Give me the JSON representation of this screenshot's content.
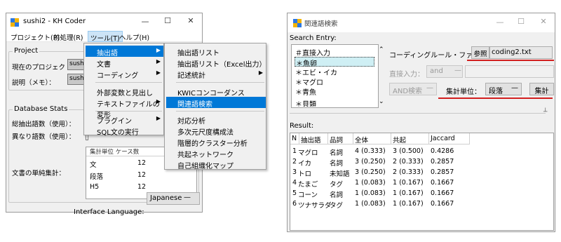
{
  "left_window": {
    "title": "sushi2 - KH Coder",
    "controls": {
      "minimize": "—",
      "maximize": "☐",
      "close": "✕"
    },
    "menubar": {
      "project": "プロジェクト(P)",
      "preprocess": "前処理(R)",
      "tools": "ツール(T)",
      "help": "ヘルプ(H)"
    },
    "project_group": {
      "legend": "Project",
      "current_project_label": "現在のプロジェクト：",
      "current_project_value": "sush",
      "memo_label": "説明（メモ）：",
      "memo_value": "sush"
    },
    "stats_group": {
      "legend": "Database Stats",
      "total_words_label": "総抽出語数（使用）：",
      "distinct_words_label": "異なり語数（使用）：",
      "unit_count_label": "文書の単純集計：",
      "unit_table": {
        "header": "集計単位 ケース数",
        "rows": [
          {
            "name": "文",
            "count": "12"
          },
          {
            "name": "段落",
            "count": "12"
          },
          {
            "name": "H5",
            "count": "12"
          }
        ]
      }
    },
    "interface_language_label": "Interface Language:",
    "interface_language_value": "Japanese"
  },
  "tools_menu": {
    "items": [
      {
        "label": "抽出語",
        "has_submenu": true,
        "highlighted": true
      },
      {
        "label": "文書",
        "has_submenu": true
      },
      {
        "label": "コーディング",
        "has_submenu": true
      },
      {
        "label": "外部変数と見出し",
        "has_submenu": false
      },
      {
        "label": "テキストファイルの変形",
        "has_submenu": true
      },
      {
        "label": "プラグイン",
        "has_submenu": true
      },
      {
        "label": "SQL文の実行",
        "has_submenu": false
      }
    ]
  },
  "sub_menu": {
    "items": [
      {
        "label": "抽出語リスト"
      },
      {
        "label": "抽出語リスト（Excel出力）"
      },
      {
        "label": "記述統計",
        "has_submenu": true
      },
      {
        "label": "KWICコンコーダンス"
      },
      {
        "label": "関連語検索",
        "highlighted": true
      },
      {
        "label": "対応分析"
      },
      {
        "label": "多次元尺度構成法"
      },
      {
        "label": "階層的クラスター分析"
      },
      {
        "label": "共起ネットワーク"
      },
      {
        "label": "自己組織化マップ"
      }
    ]
  },
  "right_window": {
    "title": "関連語検索",
    "controls": {
      "minimize": "—",
      "maximize": "☐",
      "close": "✕"
    },
    "search_entry_label": "Search Entry:",
    "entries": [
      "＃直接入力",
      "＊魚卵",
      "＊エビ・イカ",
      "＊マグロ",
      "＊青魚",
      "＊貝類"
    ],
    "selected_entry_index": 1,
    "coding_rule_label": "コーディングルール・ファイル：",
    "browse_button": "参照",
    "coding_file": "coding2.txt",
    "direct_input_label": "直接入力：",
    "direct_input_mode": "and",
    "and_search_label": "AND検索",
    "aggregation_unit_label": "集計単位：",
    "aggregation_unit_value": "段落",
    "aggregate_button": "集計",
    "result_label": "Result:",
    "result_columns": [
      "N",
      "抽出語",
      "品詞",
      "全体",
      "共起",
      "Jaccard"
    ],
    "result_rows": [
      {
        "n": "1",
        "word": "マグロ",
        "pos": "名詞",
        "total": "4 (0.333)",
        "cooc": "3 (0.500)",
        "jaccard": "0.4286"
      },
      {
        "n": "2",
        "word": "イカ",
        "pos": "名詞",
        "total": "3 (0.250)",
        "cooc": "2 (0.333)",
        "jaccard": "0.2857"
      },
      {
        "n": "3",
        "word": "トロ",
        "pos": "未知語",
        "total": "3 (0.250)",
        "cooc": "2 (0.333)",
        "jaccard": "0.2857"
      },
      {
        "n": "4",
        "word": "たまご",
        "pos": "タグ",
        "total": "1 (0.083)",
        "cooc": "1 (0.167)",
        "jaccard": "0.1667"
      },
      {
        "n": "5",
        "word": "コーン",
        "pos": "名詞",
        "total": "1 (0.083)",
        "cooc": "1 (0.167)",
        "jaccard": "0.1667"
      },
      {
        "n": "6",
        "word": "ツナサラダ",
        "pos": "タグ",
        "total": "1 (0.083)",
        "cooc": "1 (0.167)",
        "jaccard": "0.1667"
      }
    ]
  },
  "colors": {
    "menu_highlight": "#0078d7",
    "selection": "#cfeff4",
    "annotation_red": "#d21f1f"
  }
}
